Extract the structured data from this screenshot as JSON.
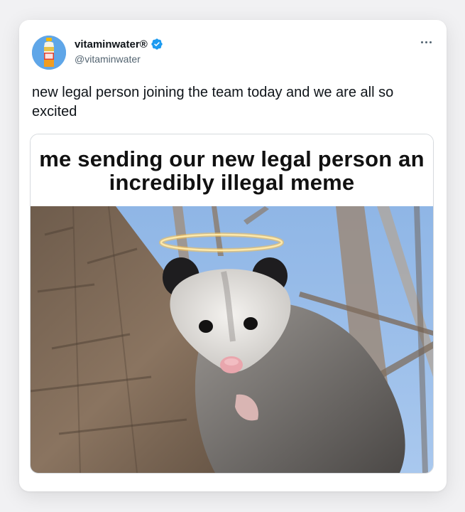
{
  "tweet": {
    "author_name": "vitaminwater®",
    "handle": "@vitaminwater",
    "verified": true,
    "text": "new legal person joining the team today and we are all so excited",
    "media": {
      "caption": "me sending our new legal person an incredibly illegal meme"
    }
  },
  "icons": {
    "avatar": "vitaminwater-bottle-avatar",
    "verified": "verified-badge-icon",
    "more": "more-options-icon"
  },
  "colors": {
    "background": "#f1f1f3",
    "card": "#ffffff",
    "text_primary": "#0f1419",
    "text_secondary": "#536471",
    "verified_blue": "#1d9bf0",
    "avatar_bg": "#5fa6e8"
  }
}
